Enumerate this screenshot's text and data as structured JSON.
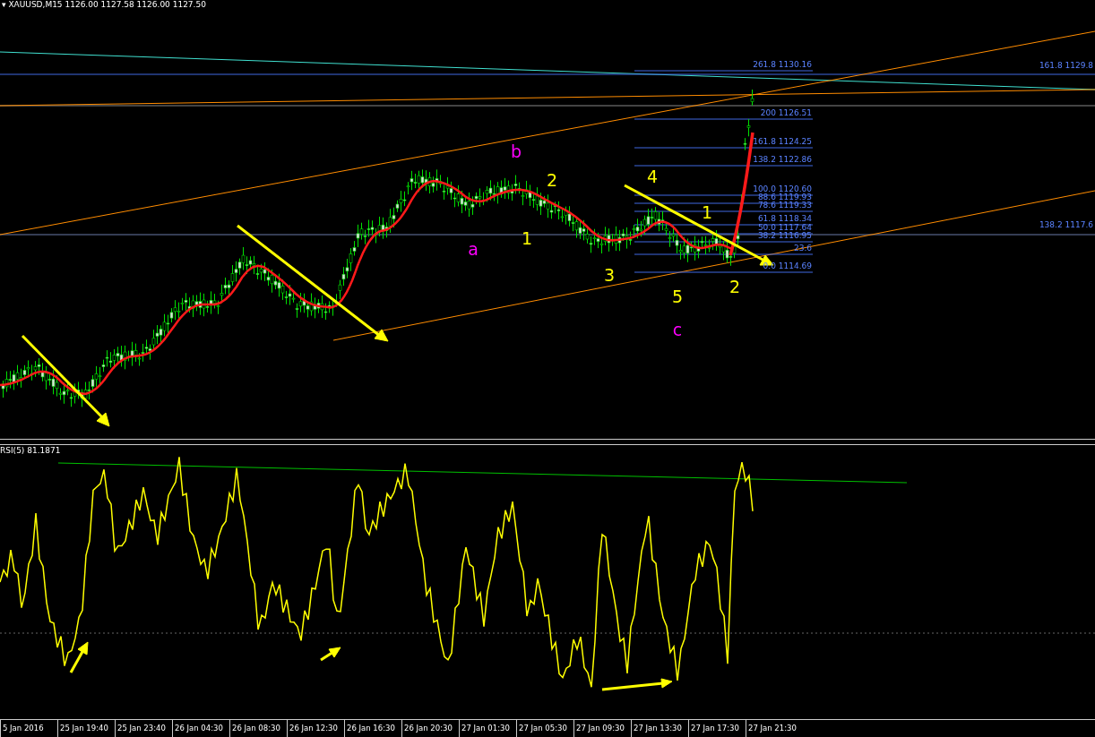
{
  "chart": {
    "title": "▾ XAUUSD,M15 1126.00 1127.58 1126.00 1127.50",
    "fib_labels": [
      {
        "text": "261.8 1130.16"
      },
      {
        "text": "200 1126.51"
      },
      {
        "text": "161.8 1124.25"
      },
      {
        "text": "138.2 1122.86"
      },
      {
        "text": "100.0 1120.60"
      },
      {
        "text": "88.6 1119.93"
      },
      {
        "text": "78.6 1119.33"
      },
      {
        "text": "61.8 1118.34"
      },
      {
        "text": "50.0 1117.64"
      },
      {
        "text": "38.2 1116.95"
      },
      {
        "text": "23.6"
      },
      {
        "text": "0.0 1114.69"
      }
    ],
    "edge_labels": [
      {
        "text": "161.8 1129.8"
      },
      {
        "text": "138.2 1117.6"
      }
    ],
    "wave_labels": [
      {
        "text": "b",
        "color": "#ff00ff"
      },
      {
        "text": "2",
        "color": "#ffff00"
      },
      {
        "text": "a",
        "color": "#ff00ff"
      },
      {
        "text": "1",
        "color": "#ffff00"
      },
      {
        "text": "4",
        "color": "#ffff00"
      },
      {
        "text": "1",
        "color": "#ffff00"
      },
      {
        "text": "3",
        "color": "#ffff00"
      },
      {
        "text": "5",
        "color": "#ffff00"
      },
      {
        "text": "2",
        "color": "#ffff00"
      },
      {
        "text": "c",
        "color": "#ff00ff"
      }
    ]
  },
  "indicator": {
    "label": "RSI(5) 81.1871"
  },
  "time_axis": {
    "labels": [
      "5 Jan 2016",
      "25 Jan 19:40",
      "25 Jan 23:40",
      "26 Jan 04:30",
      "26 Jan 08:30",
      "26 Jan 12:30",
      "26 Jan 16:30",
      "26 Jan 20:30",
      "27 Jan 01:30",
      "27 Jan 05:30",
      "27 Jan 09:30",
      "27 Jan 13:30",
      "27 Jan 17:30",
      "27 Jan 21:30"
    ]
  }
}
